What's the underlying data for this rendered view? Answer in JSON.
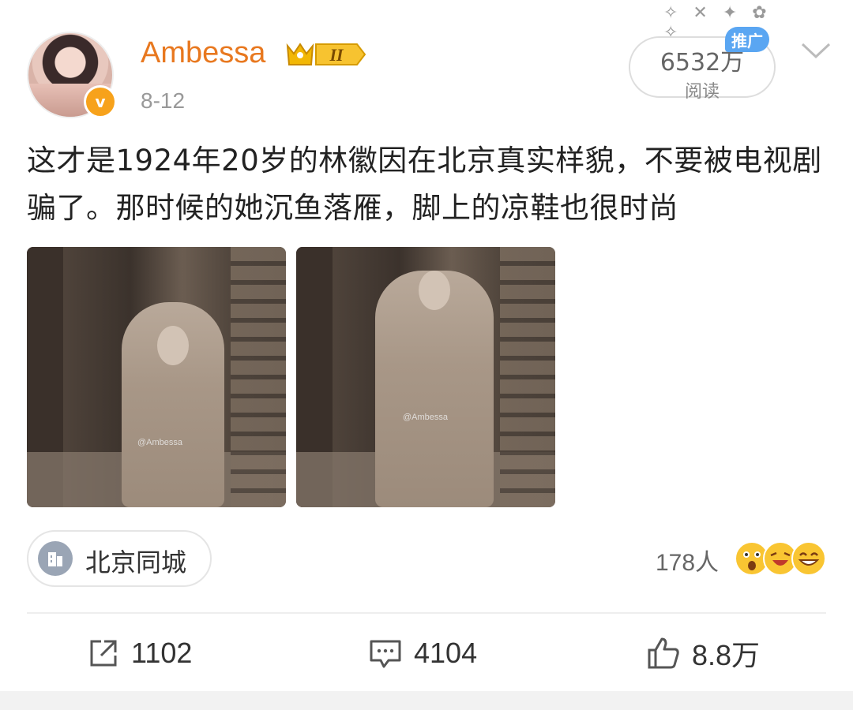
{
  "author": {
    "name": "Ambessa",
    "vip_level": "II",
    "verified_mark": "v",
    "date": "8-12"
  },
  "stats": {
    "reads_value": "6532万",
    "reads_label": "阅读",
    "ad_tag": "推广"
  },
  "post": {
    "text": "这才是1924年20岁的林徽因在北京真实样貌，不要被电视剧骗了。那时候的她沉鱼落雁，脚上的凉鞋也很时尚",
    "images": [
      {
        "watermark": "@Ambessa"
      },
      {
        "watermark": "@Ambessa"
      }
    ]
  },
  "location": {
    "label": "北京同城",
    "icon": "building-icon"
  },
  "reactions": {
    "count_text": "178人",
    "emojis": [
      "shocked-emoji-icon",
      "laughing-emoji-icon",
      "grinning-emoji-icon"
    ]
  },
  "actions": {
    "repost": {
      "count": "1102",
      "icon": "repost-icon"
    },
    "comment": {
      "count": "4104",
      "icon": "comment-icon"
    },
    "like": {
      "count": "8.8万",
      "icon": "thumbs-up-icon"
    }
  },
  "colors": {
    "username": "#e8781f",
    "ad_tag": "#5aa6f2",
    "verified": "#f7a21b"
  }
}
